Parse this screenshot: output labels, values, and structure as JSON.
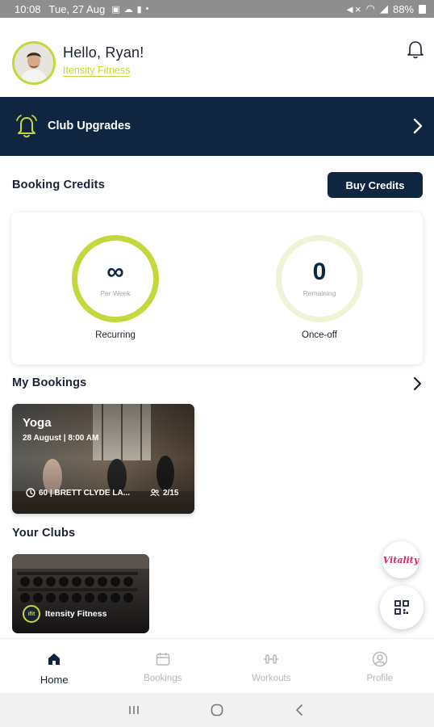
{
  "status_bar": {
    "time": "10:08",
    "date": "Tue, 27 Aug",
    "battery": "88%"
  },
  "header": {
    "greeting": "Hello, Ryan!",
    "club_name": "Itensity Fitness"
  },
  "upgrades": {
    "label": "Club Upgrades"
  },
  "credits": {
    "title": "Booking Credits",
    "buy_button": "Buy Credits",
    "recurring": {
      "value": "∞",
      "sublabel": "Per Week",
      "caption": "Recurring"
    },
    "once_off": {
      "value": "0",
      "sublabel": "Remaining",
      "caption": "Once-off"
    }
  },
  "bookings": {
    "title": "My Bookings",
    "items": [
      {
        "title": "Yoga",
        "date": "28 August | 8:00 AM",
        "meta": "60 | BRETT CLYDE LA...",
        "count": "2/15"
      }
    ]
  },
  "clubs": {
    "title": "Your Clubs",
    "items": [
      {
        "name": "Itensity Fitness",
        "logo_text": "ifit"
      }
    ]
  },
  "fabs": {
    "vitality_label": "Vitality"
  },
  "nav": {
    "items": [
      {
        "label": "Home",
        "icon": "home-icon",
        "active": true
      },
      {
        "label": "Bookings",
        "icon": "calendar-icon",
        "active": false
      },
      {
        "label": "Workouts",
        "icon": "dumbbell-icon",
        "active": false
      },
      {
        "label": "Profile",
        "icon": "profile-icon",
        "active": false
      }
    ]
  },
  "colors": {
    "accent": "#c4d83b",
    "navy": "#102640",
    "text": "#1b2233",
    "muted": "#b7b7b7"
  }
}
